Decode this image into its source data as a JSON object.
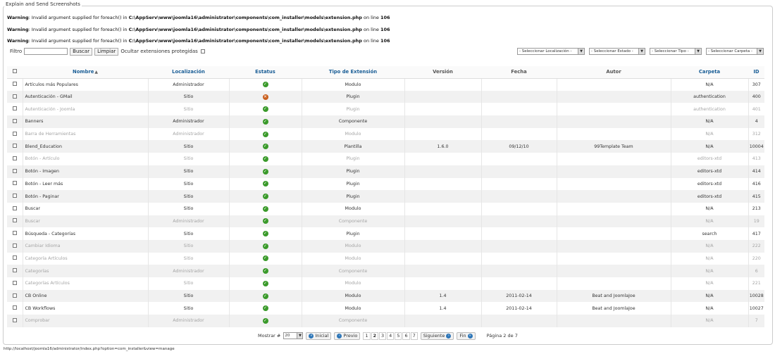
{
  "frame_title": "Explain and Send Screenshots",
  "warnings": [
    {
      "label": "Warning",
      "text1": ": Invalid argument supplied for foreach() in ",
      "path": "C:\\AppServ\\www\\joomla16\\administrator\\components\\com_installer\\models\\extension.php",
      "text2": " on line ",
      "line": "106"
    },
    {
      "label": "Warning",
      "text1": ": Invalid argument supplied for foreach() in ",
      "path": "C:\\AppServ\\www\\joomla16\\administrator\\components\\com_installer\\models\\extension.php",
      "text2": " on line ",
      "line": "106"
    },
    {
      "label": "Warning",
      "text1": ": Invalid argument supplied for foreach() in ",
      "path": "C:\\AppServ\\www\\joomla16\\administrator\\components\\com_installer\\models\\extension.php",
      "text2": " on line ",
      "line": "106"
    }
  ],
  "filter": {
    "label": "Filtro",
    "value": "",
    "search_label": "Buscar",
    "clear_label": "Limpiar",
    "hide_protected_label": "Ocultar extensiones protegidas"
  },
  "selects": {
    "location": "- Seleccionar Localización -",
    "state": "- Seleccionar Estado -",
    "type": "- Seleccionar Tipo -",
    "folder": "- Seleccionar Carpeta -"
  },
  "columns": {
    "name": "Nombre",
    "location": "Localización",
    "status": "Estatus",
    "type": "Tipo de Extensión",
    "version": "Versión",
    "date": "Fecha",
    "author": "Autor",
    "folder": "Carpeta",
    "id": "ID"
  },
  "rows": [
    {
      "name": "Artículos más Populares",
      "location": "Administrador",
      "status": "enabled",
      "type": "Modulo",
      "version": "",
      "date": "",
      "author": "",
      "folder": "N/A",
      "id": "307",
      "dim": false
    },
    {
      "name": "Autenticación - GMail",
      "location": "Sitio",
      "status": "disabled",
      "type": "Plugin",
      "version": "",
      "date": "",
      "author": "",
      "folder": "authentication",
      "id": "400",
      "dim": false
    },
    {
      "name": "Autenticación - Joomla",
      "location": "Sitio",
      "status": "enabled",
      "type": "Plugin",
      "version": "",
      "date": "",
      "author": "",
      "folder": "authentication",
      "id": "401",
      "dim": true
    },
    {
      "name": "Banners",
      "location": "Administrador",
      "status": "enabled",
      "type": "Componente",
      "version": "",
      "date": "",
      "author": "",
      "folder": "N/A",
      "id": "4",
      "dim": false
    },
    {
      "name": "Barra de Herramientas",
      "location": "Administrador",
      "status": "enabled",
      "type": "Modulo",
      "version": "",
      "date": "",
      "author": "",
      "folder": "N/A",
      "id": "312",
      "dim": true
    },
    {
      "name": "Blend_Education",
      "location": "Sitio",
      "status": "enabled",
      "type": "Plantilla",
      "version": "1.6.0",
      "date": "09/12/10",
      "author": "99Template Team",
      "folder": "N/A",
      "id": "10004",
      "dim": false
    },
    {
      "name": "Botón - Artículo",
      "location": "Sitio",
      "status": "enabled",
      "type": "Plugin",
      "version": "",
      "date": "",
      "author": "",
      "folder": "editors-xtd",
      "id": "413",
      "dim": true
    },
    {
      "name": "Botón - Imagen",
      "location": "Sitio",
      "status": "enabled",
      "type": "Plugin",
      "version": "",
      "date": "",
      "author": "",
      "folder": "editors-xtd",
      "id": "414",
      "dim": false
    },
    {
      "name": "Botón - Leer más",
      "location": "Sitio",
      "status": "enabled",
      "type": "Plugin",
      "version": "",
      "date": "",
      "author": "",
      "folder": "editors-xtd",
      "id": "416",
      "dim": false
    },
    {
      "name": "Botón - Paginar",
      "location": "Sitio",
      "status": "enabled",
      "type": "Plugin",
      "version": "",
      "date": "",
      "author": "",
      "folder": "editors-xtd",
      "id": "415",
      "dim": false
    },
    {
      "name": "Buscar",
      "location": "Sitio",
      "status": "enabled",
      "type": "Modulo",
      "version": "",
      "date": "",
      "author": "",
      "folder": "N/A",
      "id": "213",
      "dim": false
    },
    {
      "name": "Buscar",
      "location": "Administrador",
      "status": "enabled",
      "type": "Componente",
      "version": "",
      "date": "",
      "author": "",
      "folder": "N/A",
      "id": "19",
      "dim": true
    },
    {
      "name": "Búsqueda - Categorías",
      "location": "Sitio",
      "status": "enabled",
      "type": "Plugin",
      "version": "",
      "date": "",
      "author": "",
      "folder": "search",
      "id": "417",
      "dim": false
    },
    {
      "name": "Cambiar Idioma",
      "location": "Sitio",
      "status": "enabled",
      "type": "Modulo",
      "version": "",
      "date": "",
      "author": "",
      "folder": "N/A",
      "id": "222",
      "dim": true
    },
    {
      "name": "Categoría Artículos",
      "location": "Sitio",
      "status": "enabled",
      "type": "Modulo",
      "version": "",
      "date": "",
      "author": "",
      "folder": "N/A",
      "id": "220",
      "dim": true
    },
    {
      "name": "Categorías",
      "location": "Administrador",
      "status": "enabled",
      "type": "Componente",
      "version": "",
      "date": "",
      "author": "",
      "folder": "N/A",
      "id": "6",
      "dim": true
    },
    {
      "name": "Categorías Artículos",
      "location": "Sitio",
      "status": "enabled",
      "type": "Modulo",
      "version": "",
      "date": "",
      "author": "",
      "folder": "N/A",
      "id": "221",
      "dim": true
    },
    {
      "name": "CB Online",
      "location": "Sitio",
      "status": "enabled",
      "type": "Modulo",
      "version": "1.4",
      "date": "2011-02-14",
      "author": "Beat and JoomlaJoe",
      "folder": "N/A",
      "id": "10028",
      "dim": false
    },
    {
      "name": "CB Workflows",
      "location": "Sitio",
      "status": "enabled",
      "type": "Modulo",
      "version": "1.4",
      "date": "2011-02-14",
      "author": "Beat and JoomlaJoe",
      "folder": "N/A",
      "id": "10027",
      "dim": false
    },
    {
      "name": "Comprobar",
      "location": "Administrador",
      "status": "enabled",
      "type": "Componente",
      "version": "",
      "date": "",
      "author": "",
      "folder": "N/A",
      "id": "7",
      "dim": true
    }
  ],
  "pager": {
    "show_label": "Mostrar #",
    "limit": "20",
    "start": "Inicial",
    "prev": "Previo",
    "pages": [
      "1",
      "2",
      "3",
      "4",
      "5",
      "6",
      "7"
    ],
    "current_page": "2",
    "next": "Siguiente",
    "end": "Fin",
    "page_info": "Página 2 de 7"
  },
  "statusbar": "http://localhost/joomla16/administrator/index.php?option=com_installer&view=manage",
  "colors": {
    "link": "#1a5e96",
    "enabled": "#3a9a2a",
    "disabled": "#c95e1c"
  }
}
